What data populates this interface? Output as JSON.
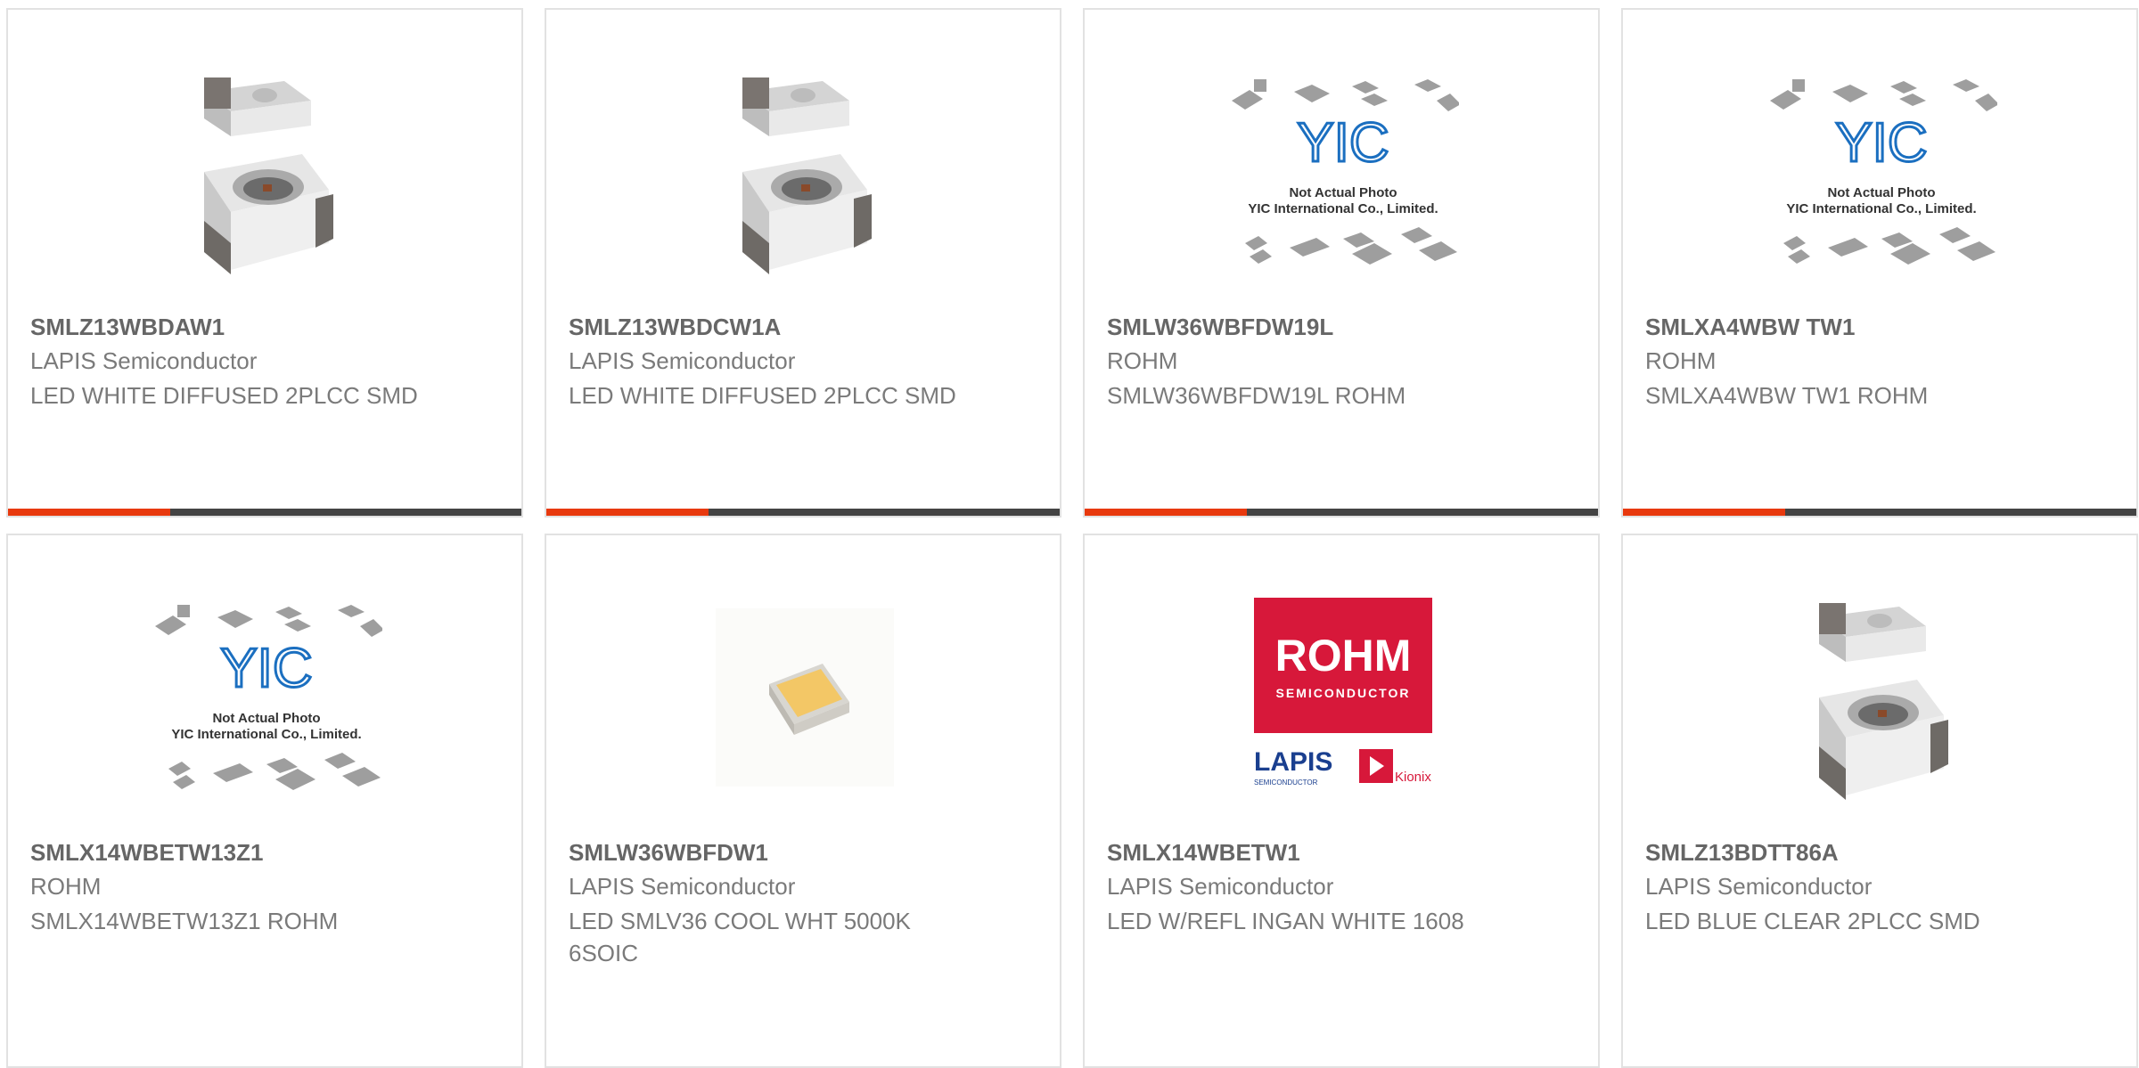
{
  "colors": {
    "accent": "#e8390e",
    "bar": "#444444",
    "rohm_red": "#d7183a",
    "lapis_blue": "#1a3f8f",
    "yic_blue": "#1b6fc0"
  },
  "products": [
    {
      "part_number": "SMLZ13WBDAW1",
      "manufacturer": "LAPIS Semiconductor",
      "description": "LED WHITE DIFFUSED 2PLCC SMD",
      "image": "led-2plcc-photo"
    },
    {
      "part_number": "SMLZ13WBDCW1A",
      "manufacturer": "LAPIS Semiconductor",
      "description": "LED WHITE DIFFUSED 2PLCC SMD",
      "image": "led-2plcc-photo"
    },
    {
      "part_number": "SMLW36WBFDW19L",
      "manufacturer": "ROHM",
      "description": "SMLW36WBFDW19L ROHM",
      "image": "yic-placeholder",
      "image_text": [
        "Not Actual Photo",
        "YIC International Co., Limited."
      ]
    },
    {
      "part_number": "SMLXA4WBW TW1",
      "manufacturer": "ROHM",
      "description": "SMLXA4WBW TW1 ROHM",
      "image": "yic-placeholder",
      "image_text": [
        "Not Actual Photo",
        "YIC International Co., Limited."
      ]
    },
    {
      "part_number": "SMLX14WBETW13Z1",
      "manufacturer": "ROHM",
      "description": "SMLX14WBETW13Z1 ROHM",
      "image": "yic-placeholder",
      "image_text": [
        "Not Actual Photo",
        "YIC International Co., Limited."
      ]
    },
    {
      "part_number": "SMLW36WBFDW1",
      "manufacturer": "LAPIS Semiconductor",
      "description": "LED SMLV36 COOL WHT 5000K 6SOIC",
      "image": "led-chip-photo"
    },
    {
      "part_number": "SMLX14WBETW1",
      "manufacturer": "LAPIS Semiconductor",
      "description": "LED W/REFL INGAN WHITE 1608",
      "image": "rohm-logo",
      "image_text": [
        "ROHM",
        "SEMICONDUCTOR",
        "LAPIS",
        "SEMICONDUCTOR",
        "Kionix"
      ]
    },
    {
      "part_number": "SMLZ13BDTT86A",
      "manufacturer": "LAPIS Semiconductor",
      "description": "LED BLUE CLEAR 2PLCC SMD",
      "image": "led-2plcc-photo"
    }
  ]
}
